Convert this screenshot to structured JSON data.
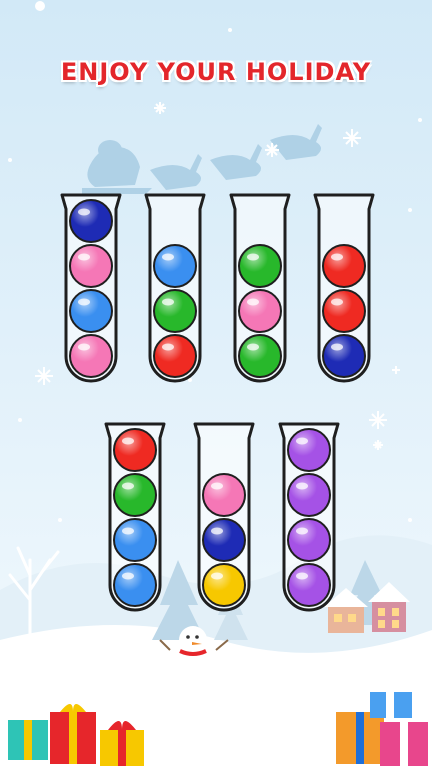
{
  "banner": {
    "text": "ENJOY YOUR HOLIDAY"
  },
  "colors": {
    "blue": "#3a8ff0",
    "navy": "#1e2bb5",
    "pink": "#f577b6",
    "green": "#28b82b",
    "red": "#ef2a22",
    "yellow": "#f7c800",
    "purple": "#a552e6",
    "sky_top": "#d2e9f7",
    "sky_bottom": "#eef7fc",
    "title_red": "#e3262b"
  },
  "tubes": [
    {
      "id": "tube-1",
      "balls": [
        "navy",
        "pink",
        "blue",
        "pink"
      ]
    },
    {
      "id": "tube-2",
      "balls": [
        "blue",
        "green",
        "red"
      ]
    },
    {
      "id": "tube-3",
      "balls": [
        "green",
        "pink",
        "green"
      ]
    },
    {
      "id": "tube-4",
      "balls": [
        "red",
        "red",
        "navy"
      ]
    },
    {
      "id": "tube-5",
      "balls": [
        "red",
        "green",
        "blue",
        "blue"
      ]
    },
    {
      "id": "tube-6",
      "balls": [
        "pink",
        "navy",
        "yellow"
      ]
    },
    {
      "id": "tube-7",
      "balls": [
        "purple",
        "purple",
        "purple",
        "purple"
      ]
    }
  ]
}
